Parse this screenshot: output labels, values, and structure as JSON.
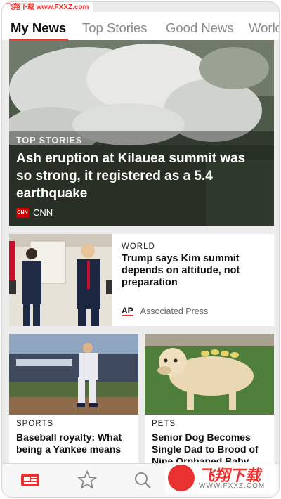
{
  "watermark_top": "飞翔下载 www.FXXZ.com",
  "tabs": [
    "My News",
    "Top Stories",
    "Good News",
    "World"
  ],
  "hero": {
    "kicker": "TOP STORIES",
    "headline": "Ash eruption at Kilauea summit was so strong, it registered as a 5.4 earthquake",
    "source_logo": "CNN",
    "source": "CNN"
  },
  "story2": {
    "kicker": "WORLD",
    "headline": "Trump says Kim summit depends on attitude, not preparation",
    "source_logo": "AP",
    "source": "Associated Press"
  },
  "story3": {
    "kicker": "SPORTS",
    "headline": "Baseball royalty: What being a Yankee means"
  },
  "story4": {
    "kicker": "PETS",
    "headline": "Senior Dog Becomes Single Dad to Brood of Nine Orphaned Baby Ducks"
  },
  "tabbar_icons": [
    "news-icon",
    "star-icon",
    "search-icon",
    "profile-icon"
  ],
  "watermark_bottom": {
    "title": "飞翔下载",
    "url": "WWW.FXXZ.COM"
  },
  "colors": {
    "accent": "#e8322f",
    "tab_inactive": "#8c8c8c"
  }
}
